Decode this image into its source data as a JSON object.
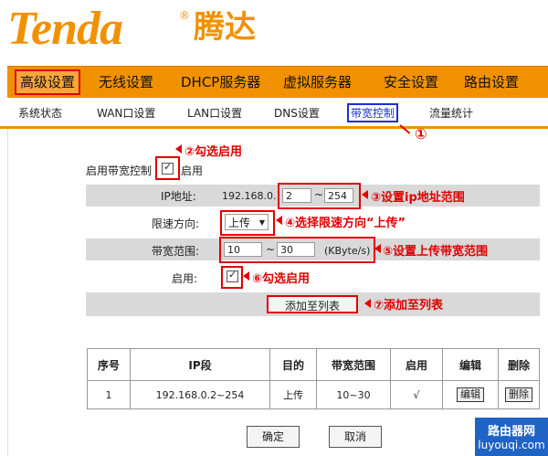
{
  "brand": {
    "logo": "Tenda",
    "reg": "®",
    "cn": "腾达"
  },
  "nav": [
    {
      "label": "高级设置",
      "active": true
    },
    {
      "label": "无线设置"
    },
    {
      "label": "DHCP服务器"
    },
    {
      "label": "虚拟服务器"
    },
    {
      "label": "安全设置"
    },
    {
      "label": "路由设置"
    }
  ],
  "subnav": [
    {
      "label": "系统状态"
    },
    {
      "label": "WAN口设置"
    },
    {
      "label": "LAN口设置"
    },
    {
      "label": "DNS设置"
    },
    {
      "label": "带宽控制",
      "active": true
    },
    {
      "label": "流量统计"
    }
  ],
  "form": {
    "enable_bw_label": "启用带宽控制",
    "enable_bw_checked": true,
    "enable_text": "启用",
    "ip_label": "IP地址:",
    "ip_prefix": "192.168.0.",
    "ip_start": "2",
    "ip_sep": "~",
    "ip_end": "254",
    "direction_label": "限速方向:",
    "direction_value": "上传",
    "bw_label": "带宽范围:",
    "bw_min": "10",
    "bw_sep": "~",
    "bw_max": "30",
    "bw_unit": "(KByte/s)",
    "enable_label": "启用:",
    "enable_checked": true,
    "add_button": "添加至列表"
  },
  "annotations": {
    "a1": "①",
    "a2": "②勾选启用",
    "a3": "③设置ip地址范围",
    "a4": "④选择限速方向“上传”",
    "a5": "⑤设置上传带宽范围",
    "a6": "⑥勾选启用",
    "a7": "⑦添加至列表"
  },
  "table": {
    "headers": [
      "序号",
      "IP段",
      "目的",
      "带宽范围",
      "启用",
      "编辑",
      "删除"
    ],
    "rows": [
      {
        "no": "1",
        "ip": "192.168.0.2~254",
        "dest": "上传",
        "range": "10~30",
        "enabled": "√",
        "edit": "编辑",
        "delete": "删除"
      }
    ]
  },
  "buttons": {
    "ok": "确定",
    "cancel": "取消"
  },
  "watermark": {
    "line1": "路由器网",
    "line2": "luyouqi.com"
  },
  "colors": {
    "brand_orange": "#f29100",
    "annotation_red": "#e00000",
    "active_blue": "#1a2fd8"
  }
}
